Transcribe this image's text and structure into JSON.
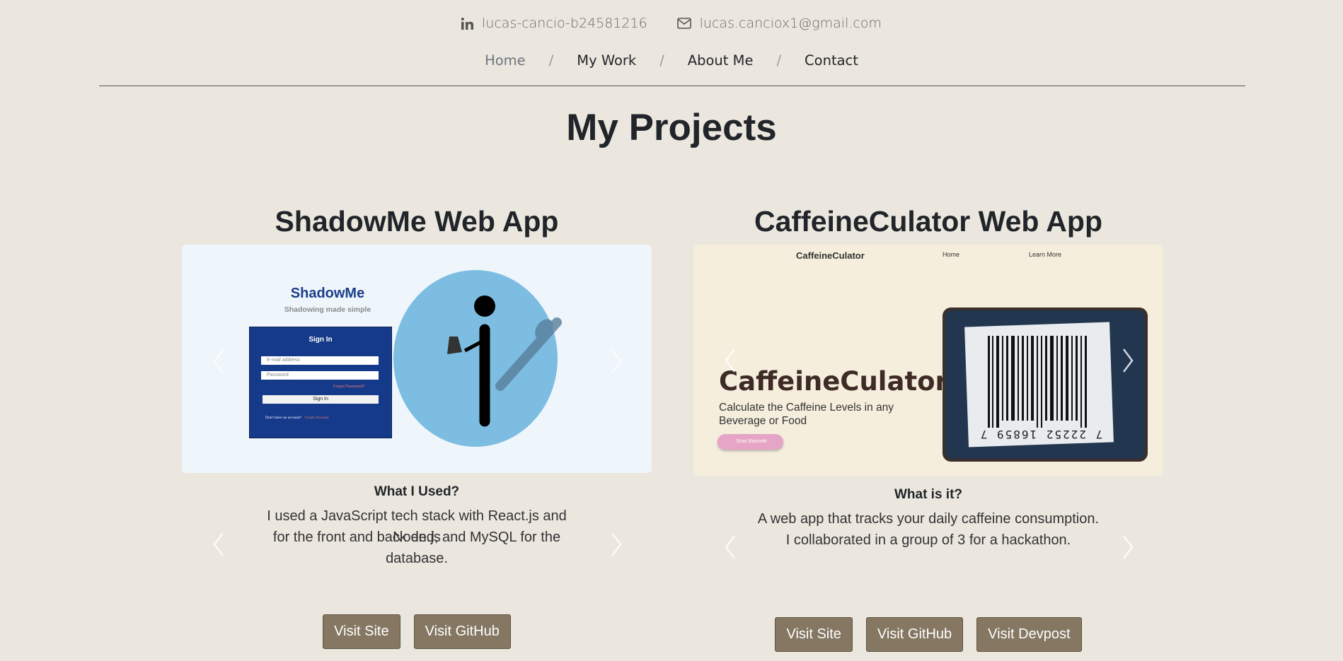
{
  "contact": {
    "linkedin_icon": "linkedin-icon",
    "linkedin": "lucas-cancio-b24581216",
    "email_icon": "envelope-icon",
    "email": "lucas.canciox1@gmail.com"
  },
  "nav": {
    "items": [
      "Home",
      "My Work",
      "About Me",
      "Contact"
    ],
    "separator": "/",
    "active": "Home"
  },
  "page_title": "My Projects",
  "projects": [
    {
      "title": "ShadowMe Web App",
      "screenshot": {
        "brand": "ShadowMe",
        "tagline": "Shadowing made simple",
        "signin_title": "Sign In",
        "email_placeholder": "E-mail address",
        "password_placeholder": "Password",
        "forgot": "Forgot Password?",
        "signin_button": "Sign In",
        "no_account": "Don't have an account?",
        "create": "Create Account"
      },
      "caption_head": "What I Used?",
      "caption_line1": "I used a JavaScript tech stack with React.js and Node.js",
      "caption_line2": "for the front and back end, and MySQL for the database.",
      "buttons": [
        "Visit Site",
        "Visit GitHub"
      ]
    },
    {
      "title": "CaffeineCulator Web App",
      "screenshot": {
        "brand": "CaffeineCulator",
        "nav_home": "Home",
        "nav_learn": "Learn More",
        "hero": "CaffeineCulator",
        "subtitle_1": "Calculate the Caffeine Levels in any",
        "subtitle_2": "Beverage or Food",
        "scan_button": "Scan Barcode",
        "barcode_digits": "7  22252  16859  7"
      },
      "caption_head": "What is it?",
      "caption_line1": "A web app that tracks your daily caffeine consumption.",
      "caption_line2": "I collaborated in a group of 3 for a hackathon.",
      "buttons": [
        "Visit Site",
        "Visit GitHub",
        "Visit Devpost"
      ]
    }
  ],
  "colors": {
    "background": "#ebe7df",
    "button": "#857762",
    "shadowme_panel": "#e8f4fc",
    "shadowme_signin": "#163a8a",
    "shadowme_circle": "#7dbde2",
    "caffeine_panel": "#f5eedd"
  }
}
